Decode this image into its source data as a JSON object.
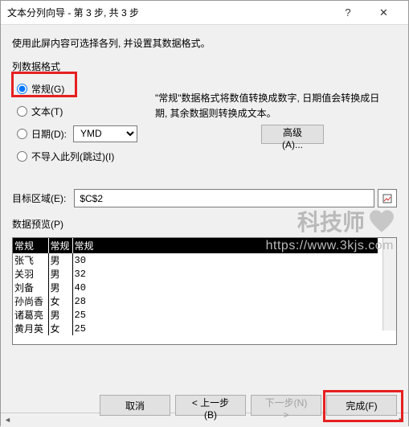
{
  "titlebar": {
    "title": "文本分列向导 - 第 3 步, 共 3 步"
  },
  "instruction": "使用此屏内容可选择各列, 并设置其数据格式。",
  "group": {
    "label": "列数据格式"
  },
  "radios": {
    "general": "常规(G)",
    "text": "文本(T)",
    "date": "日期(D):",
    "skip": "不导入此列(跳过)(I)"
  },
  "date_format": "YMD",
  "description": "\"常规\"数据格式将数值转换成数字, 日期值会转换成日期, 其余数据则转换成文本。",
  "advanced_btn": "高级(A)...",
  "target": {
    "label": "目标区域(E):",
    "value": "$C$2"
  },
  "preview": {
    "label": "数据预览(P)",
    "headers": [
      "常规",
      "常规",
      "常规"
    ],
    "rows": [
      [
        "张飞",
        "男",
        "30"
      ],
      [
        "关羽",
        "男",
        "32"
      ],
      [
        "刘备",
        "男",
        "40"
      ],
      [
        "孙尚香",
        "女",
        "28"
      ],
      [
        "诸葛亮",
        "男",
        "25"
      ],
      [
        "黄月英",
        "女",
        "25"
      ]
    ]
  },
  "footer": {
    "cancel": "取消",
    "back": "< 上一步(B)",
    "next": "下一步(N) >",
    "finish": "完成(F)"
  },
  "watermark": {
    "line1": "科技师",
    "line2": "https://www.3kjs.com"
  }
}
